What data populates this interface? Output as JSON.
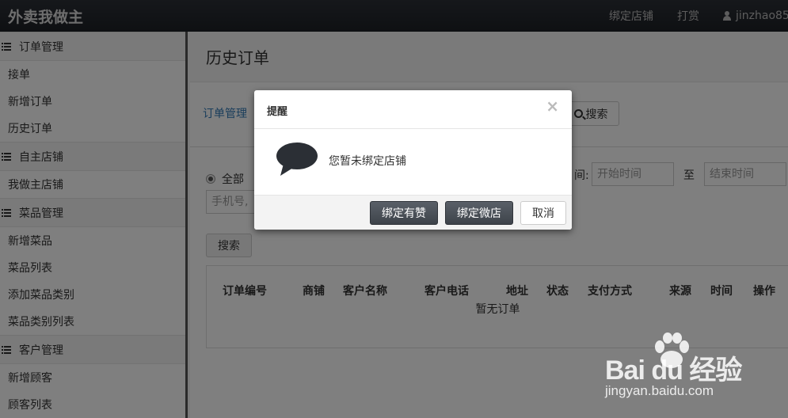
{
  "app": {
    "brand": "外卖我做主"
  },
  "topnav": {
    "bind_shop": "绑定店铺",
    "reward": "打赏",
    "username": "jinzhao85"
  },
  "sidebar": {
    "groups": [
      {
        "title": "订单管理",
        "items": [
          "接单",
          "新增订单",
          "历史订单"
        ]
      },
      {
        "title": "自主店铺",
        "items": [
          "我做主店铺"
        ]
      },
      {
        "title": "菜品管理",
        "items": [
          "新增菜品",
          "菜品列表",
          "添加菜品类别",
          "菜品类别列表"
        ]
      },
      {
        "title": "客户管理",
        "items": [
          "新增顾客",
          "顾客列表"
        ]
      }
    ]
  },
  "page": {
    "title": "历史订单",
    "breadcrumb": "订单管理",
    "search_button": "搜索"
  },
  "filter": {
    "radio_all": "全部",
    "time_label": "间:",
    "start_placeholder": "开始时间",
    "to_label": "至",
    "end_placeholder": "结束时间",
    "phone_placeholder": "手机号,",
    "search_button": "搜索"
  },
  "table": {
    "columns": [
      "订单编号",
      "商铺",
      "客户名称",
      "客户电话",
      "地址",
      "状态",
      "支付方式",
      "来源",
      "时间",
      "操作"
    ],
    "empty_text": "暂无订单"
  },
  "modal": {
    "title": "提醒",
    "close": "×",
    "message": "您暂未绑定店铺",
    "buttons": {
      "bind_youzan": "绑定有赞",
      "bind_weidian": "绑定微店",
      "cancel": "取消"
    }
  },
  "watermark": {
    "logo": "Bai du 经验",
    "url": "jingyan.baidu.com"
  },
  "colors": {
    "link": "#337ab7",
    "topbar": "#23272d",
    "primary_button": "#4a4f56"
  }
}
